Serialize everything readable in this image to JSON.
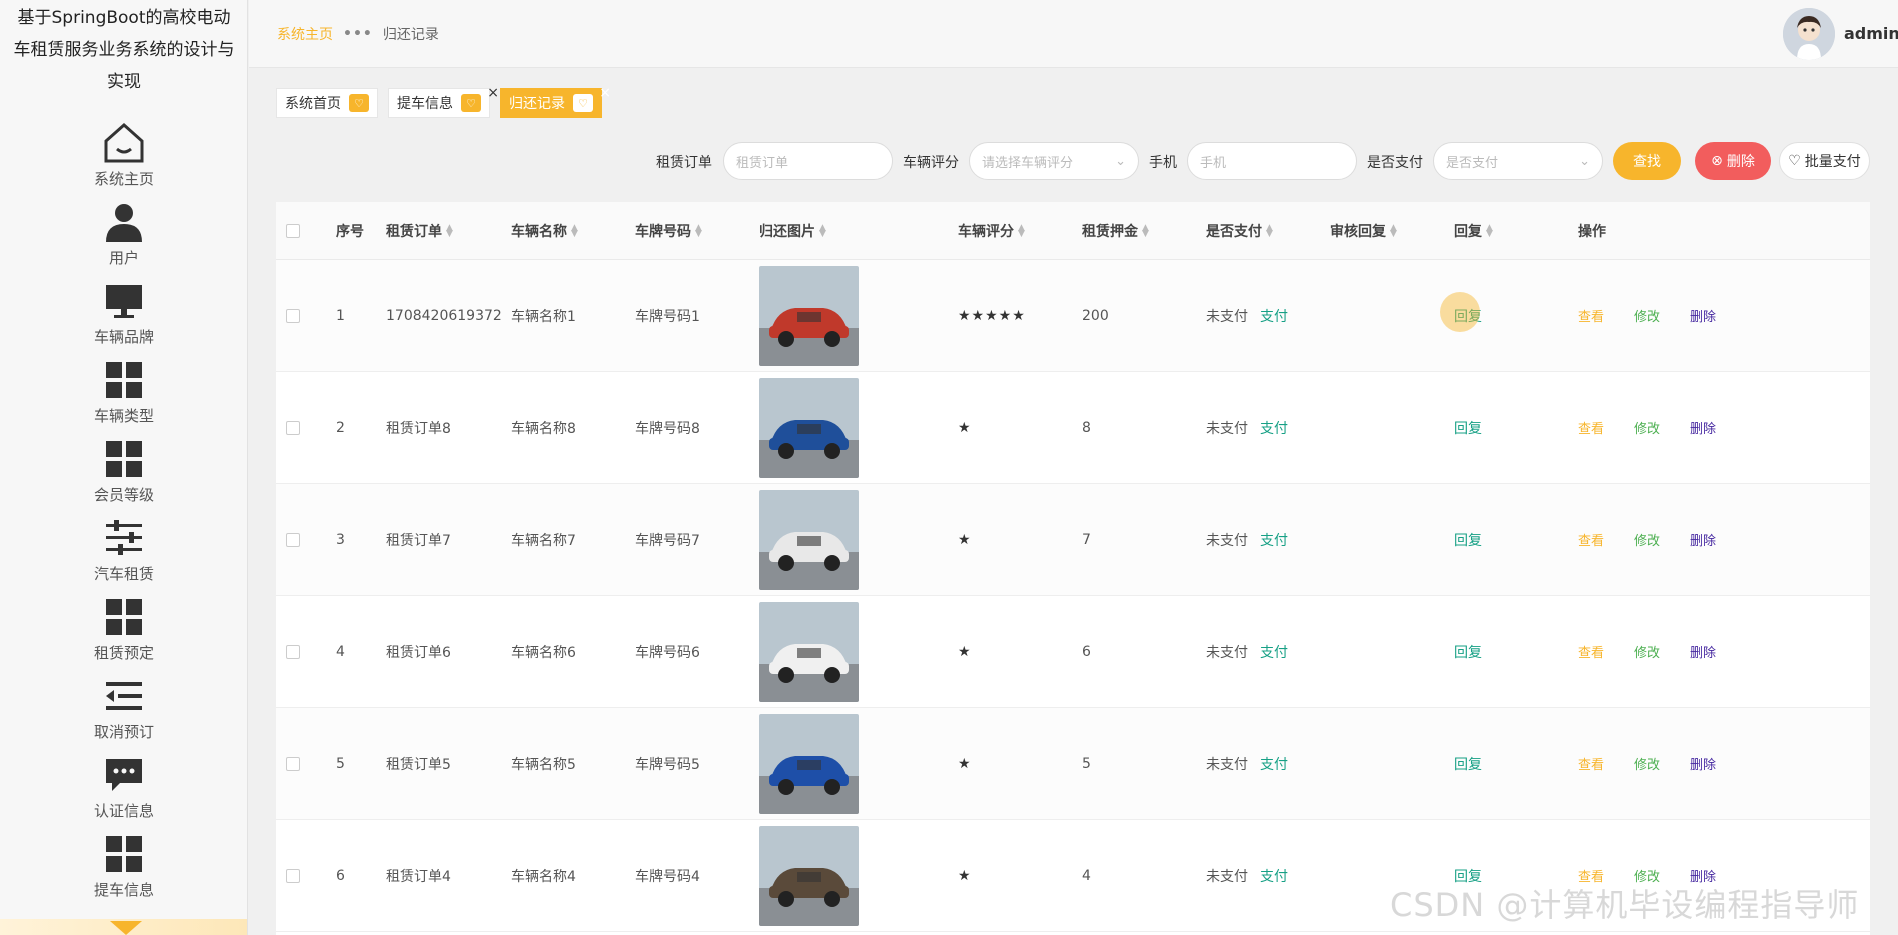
{
  "sidebar": {
    "title": "基于SpringBoot的高校电动车租赁服务业务系统的设计与实现",
    "items": [
      {
        "label": "系统主页",
        "icon": "home-icon"
      },
      {
        "label": "用户",
        "icon": "user-icon"
      },
      {
        "label": "车辆品牌",
        "icon": "monitor-icon"
      },
      {
        "label": "车辆类型",
        "icon": "grid-icon"
      },
      {
        "label": "会员等级",
        "icon": "grid-icon"
      },
      {
        "label": "汽车租赁",
        "icon": "sliders-icon"
      },
      {
        "label": "租赁预定",
        "icon": "grid-icon"
      },
      {
        "label": "取消预订",
        "icon": "list-icon"
      },
      {
        "label": "认证信息",
        "icon": "chat-icon"
      },
      {
        "label": "提车信息",
        "icon": "grid-icon"
      }
    ]
  },
  "header": {
    "breadcrumb_home": "系统主页",
    "breadcrumb_sep": "•••",
    "breadcrumb_current": "归还记录",
    "username": "admin"
  },
  "tags": [
    {
      "label": "系统首页",
      "active": false,
      "closable": false
    },
    {
      "label": "提车信息",
      "active": false,
      "closable": true
    },
    {
      "label": "归还记录",
      "active": true,
      "closable": true
    }
  ],
  "search": {
    "order_label": "租赁订单",
    "order_placeholder": "租赁订单",
    "rating_label": "车辆评分",
    "rating_placeholder": "请选择车辆评分",
    "phone_label": "手机",
    "phone_placeholder": "手机",
    "paid_label": "是否支付",
    "paid_placeholder": "是否支付",
    "search_button": "查找",
    "delete_button": "删除",
    "batch_pay_button": "批量支付"
  },
  "table": {
    "headers": [
      "序号",
      "租赁订单",
      "车辆名称",
      "车牌号码",
      "归还图片",
      "车辆评分",
      "租赁押金",
      "是否支付",
      "审核回复",
      "回复",
      "操作"
    ],
    "pay_link": "支付",
    "reply_link": "回复",
    "view_link": "查看",
    "edit_link": "修改",
    "delete_link": "删除",
    "rows": [
      {
        "index": "1",
        "order": "1708420619372",
        "name": "车辆名称1",
        "plate": "车牌号码1",
        "rating": "★★★★★",
        "deposit": "200",
        "paid": "未支付",
        "review": "",
        "car_color": "#c0392b"
      },
      {
        "index": "2",
        "order": "租赁订单8",
        "name": "车辆名称8",
        "plate": "车牌号码8",
        "rating": "★",
        "deposit": "8",
        "paid": "未支付",
        "review": "",
        "car_color": "#1f4f9a"
      },
      {
        "index": "3",
        "order": "租赁订单7",
        "name": "车辆名称7",
        "plate": "车牌号码7",
        "rating": "★",
        "deposit": "7",
        "paid": "未支付",
        "review": "",
        "car_color": "#e8e8e8"
      },
      {
        "index": "4",
        "order": "租赁订单6",
        "name": "车辆名称6",
        "plate": "车牌号码6",
        "rating": "★",
        "deposit": "6",
        "paid": "未支付",
        "review": "",
        "car_color": "#f0f0f0"
      },
      {
        "index": "5",
        "order": "租赁订单5",
        "name": "车辆名称5",
        "plate": "车牌号码5",
        "rating": "★",
        "deposit": "5",
        "paid": "未支付",
        "review": "",
        "car_color": "#1e4fa8"
      },
      {
        "index": "6",
        "order": "租赁订单4",
        "name": "车辆名称4",
        "plate": "车牌号码4",
        "rating": "★",
        "deposit": "4",
        "paid": "未支付",
        "review": "",
        "car_color": "#5a4a3a"
      }
    ]
  },
  "watermark": "CSDN @计算机毕设编程指导师"
}
